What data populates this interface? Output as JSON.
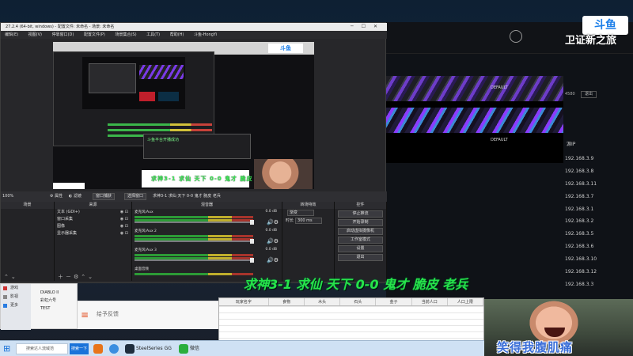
{
  "obs": {
    "title": "27.2.4 (64-bit, windows) - 配置文件: 未命名 - 场景: 未命名",
    "menu": [
      "编辑(E)",
      "视图(V)",
      "停靠窗口(D)",
      "配置文件(P)",
      "场景集合(S)",
      "工具(T)",
      "帮助(H)",
      "斗鱼-HongYi"
    ],
    "toolbar": {
      "status": "100%",
      "props": "属性",
      "filters": "滤镜",
      "window_capture": "窗口捕获",
      "window_title": "选择窗口",
      "window_value": "求神3-1 求仙 天下 0-0 鬼才 脆皮 老兵"
    },
    "docks": {
      "scenes": "场景",
      "sources": "来源",
      "mixer": "混音器",
      "transitions": "转场特效",
      "controls": "控件"
    },
    "sources": [
      {
        "label": "文本 (GDI+)"
      },
      {
        "label": "窗口采集"
      },
      {
        "label": "图像"
      },
      {
        "label": "显示器采集"
      }
    ],
    "mixer": [
      {
        "name": "麦克风/Aux",
        "db": "0.0 dB"
      },
      {
        "name": "麦克风/Aux 2",
        "db": "0.0 dB"
      },
      {
        "name": "麦克风/Aux 3",
        "db": "0.0 dB"
      },
      {
        "name": "桌面音频",
        "db": ""
      }
    ],
    "transitions": {
      "type": "渐变",
      "duration_label": "时长",
      "duration": "300 ms"
    },
    "controls": [
      "停止推流",
      "开始录制",
      "启动虚拟摄像机",
      "工作室模式",
      "设置",
      "退出"
    ]
  },
  "preview": {
    "caption": "求神3-1 求仙 天下 0-0 鬼才 脆皮 老兵",
    "tool_text": "斗鱼平台开播成功"
  },
  "big_caption": "求神3-1 求仙 天下 0-0 鬼才 脆皮 老兵",
  "bg_app": {
    "user_text": "",
    "default_1": "DEFAULT",
    "default_2": "DEFAULT",
    "id_text": "4580",
    "id_btn": "退出",
    "ip_header": "源IP",
    "ips": [
      "192.168.3.9",
      "192.168.3.8",
      "192.168.3.11",
      "192.168.3.7",
      "192.168.3.1",
      "192.168.3.2",
      "192.168.3.5",
      "192.168.3.6",
      "192.168.3.10",
      "192.168.3.12",
      "192.168.3.3"
    ]
  },
  "logo": {
    "top": "斗鱼",
    "sub": "卫证新之旅"
  },
  "side_panel": {
    "items": [
      "游戏",
      "影视",
      "更多"
    ],
    "games": [
      "DIABLO II",
      "彩虹六号",
      "TEST"
    ]
  },
  "feedback": {
    "text": "给予反馈"
  },
  "sheet": {
    "headers": [
      "玩家名字",
      "食物",
      "木头",
      "石头",
      "金子",
      "当前人口",
      "人口上限"
    ]
  },
  "webcam": {
    "caption": "笑得我腹肌痛"
  },
  "taskbar": {
    "search_placeholder": "搜索达人流域范",
    "search_btn": "搜索一下",
    "steelseries": "SteelSeries GG",
    "wechat": "微信"
  },
  "colors": {
    "caption_green": "#26e34a",
    "accent_purple": "#7a3ae8",
    "taskbar": "#cfe1f4"
  }
}
